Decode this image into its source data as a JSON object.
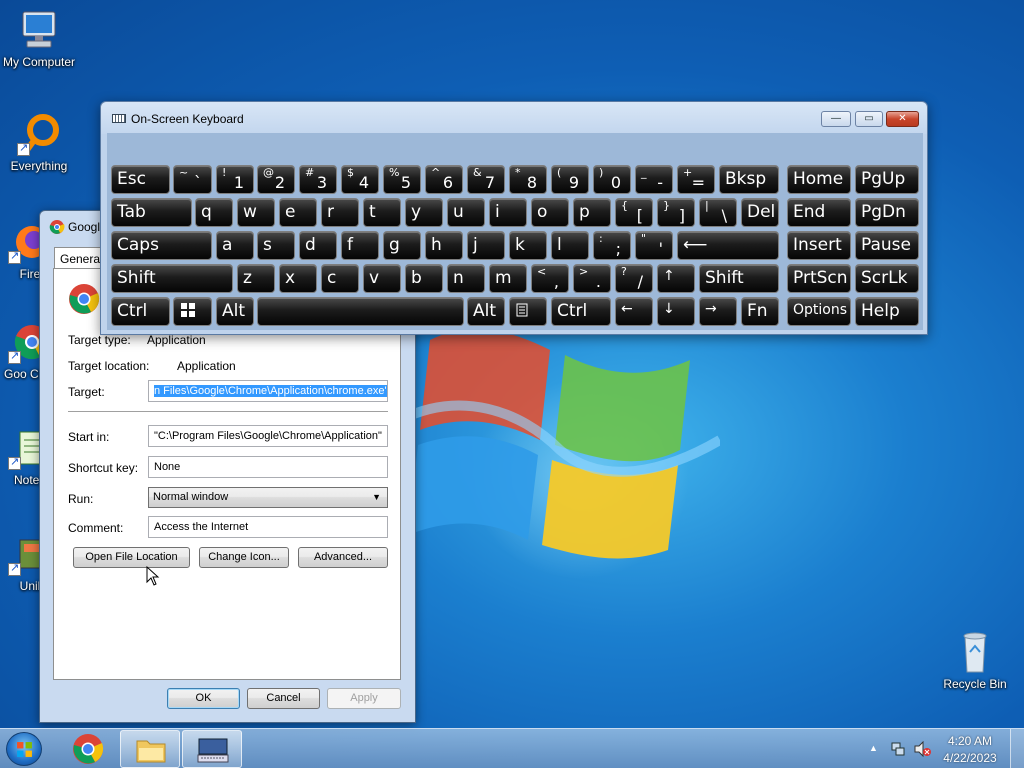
{
  "desktop": {
    "icons": [
      {
        "label": "My Computer"
      },
      {
        "label": "Everything"
      },
      {
        "label": "Fire"
      },
      {
        "label": "Goo Chro"
      },
      {
        "label": "Notep"
      },
      {
        "label": "Unil"
      },
      {
        "label": "Recycle Bin"
      }
    ]
  },
  "properties": {
    "title": "Googl",
    "tab": "General",
    "fields": {
      "target_type_label": "Target type:",
      "target_type_value": "Application",
      "target_location_label": "Target location:",
      "target_location_value": "Application",
      "target_label": "Target:",
      "target_value": "n Files\\Google\\Chrome\\Application\\chrome.exe\"",
      "start_in_label": "Start in:",
      "start_in_value": "\"C:\\Program Files\\Google\\Chrome\\Application\"",
      "shortcut_key_label": "Shortcut key:",
      "shortcut_key_value": "None",
      "run_label": "Run:",
      "run_value": "Normal window",
      "comment_label": "Comment:",
      "comment_value": "Access the Internet"
    },
    "buttons": {
      "open_file_location": "Open File Location",
      "change_icon": "Change Icon...",
      "advanced": "Advanced...",
      "ok": "OK",
      "cancel": "Cancel",
      "apply": "Apply"
    }
  },
  "osk": {
    "title": "On-Screen Keyboard",
    "caption": {
      "minimize": "—",
      "restore": "▭",
      "close": "✕"
    },
    "keys": {
      "esc": "Esc",
      "tilde_top": "~",
      "tilde_bot": "`",
      "k1_top": "!",
      "k1": "1",
      "k2_top": "@",
      "k2": "2",
      "k3_top": "#",
      "k3": "3",
      "k4_top": "$",
      "k4": "4",
      "k5_top": "%",
      "k5": "5",
      "k6_top": "^",
      "k6": "6",
      "k7_top": "&",
      "k7": "7",
      "k8_top": "*",
      "k8": "8",
      "k9_top": "(",
      "k9": "9",
      "k0_top": ")",
      "k0": "0",
      "minus_top": "_",
      "minus": "-",
      "eq_top": "+",
      "eq": "=",
      "bksp": "Bksp",
      "home": "Home",
      "pgup": "PgUp",
      "tab": "Tab",
      "q": "q",
      "w": "w",
      "e": "e",
      "r": "r",
      "t": "t",
      "y": "y",
      "u": "u",
      "i": "i",
      "o": "o",
      "p": "p",
      "lbr_top": "{",
      "lbr": "[",
      "rbr_top": "}",
      "rbr": "]",
      "bsl_top": "|",
      "bsl": "\\",
      "del": "Del",
      "end": "End",
      "pgdn": "PgDn",
      "caps": "Caps",
      "a": "a",
      "s": "s",
      "d": "d",
      "f": "f",
      "g": "g",
      "h": "h",
      "j": "j",
      "k": "k",
      "l": "l",
      "semi_top": ":",
      "semi": ";",
      "quote_top": "\"",
      "quote": "'",
      "enter": "⟵",
      "insert": "Insert",
      "pause": "Pause",
      "shift": "Shift",
      "z": "z",
      "x": "x",
      "c": "c",
      "v": "v",
      "b": "b",
      "n": "n",
      "m": "m",
      "comma_top": "<",
      "comma": ",",
      "period_top": ">",
      "period": ".",
      "slash_top": "?",
      "slash": "/",
      "up": "↑",
      "rshift": "Shift",
      "prtscn": "PrtScn",
      "scrlk": "ScrLk",
      "ctrl": "Ctrl",
      "alt": "Alt",
      "ralt": "Alt",
      "rctrl": "Ctrl",
      "left": "←",
      "down": "↓",
      "right": "→",
      "fn": "Fn",
      "options": "Options",
      "help": "Help"
    }
  },
  "taskbar": {
    "time": "4:20 AM",
    "date": "4/22/2023",
    "tray_arrow": "▲"
  }
}
